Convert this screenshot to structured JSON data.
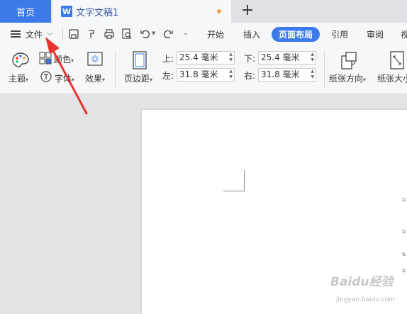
{
  "tabs": {
    "home": "首页",
    "doc_logo": "W",
    "doc_title": "文字文稿1",
    "new_tab": "+"
  },
  "menu": {
    "file": "文件",
    "ribbon_tabs": [
      "开始",
      "插入",
      "页面布局",
      "引用",
      "审阅",
      "视"
    ],
    "active_tab": "页面布局"
  },
  "ribbon": {
    "theme": "主题",
    "color": "颜色",
    "font": "字体",
    "effect": "效果",
    "margins": "页边距",
    "top_label": "上:",
    "top_value": "25.4 毫米",
    "bottom_label": "下:",
    "bottom_value": "25.4 毫米",
    "left_label": "左:",
    "left_value": "31.8 毫米",
    "right_label": "右:",
    "right_value": "31.8 毫米",
    "orientation": "纸张方向",
    "size": "纸张大小"
  },
  "colors": {
    "accent": "#3b7ae8",
    "arrow": "#e8322f",
    "tab_dot": "#f0a048"
  },
  "watermark": "Baidu经验 jingyan.baidu.com"
}
